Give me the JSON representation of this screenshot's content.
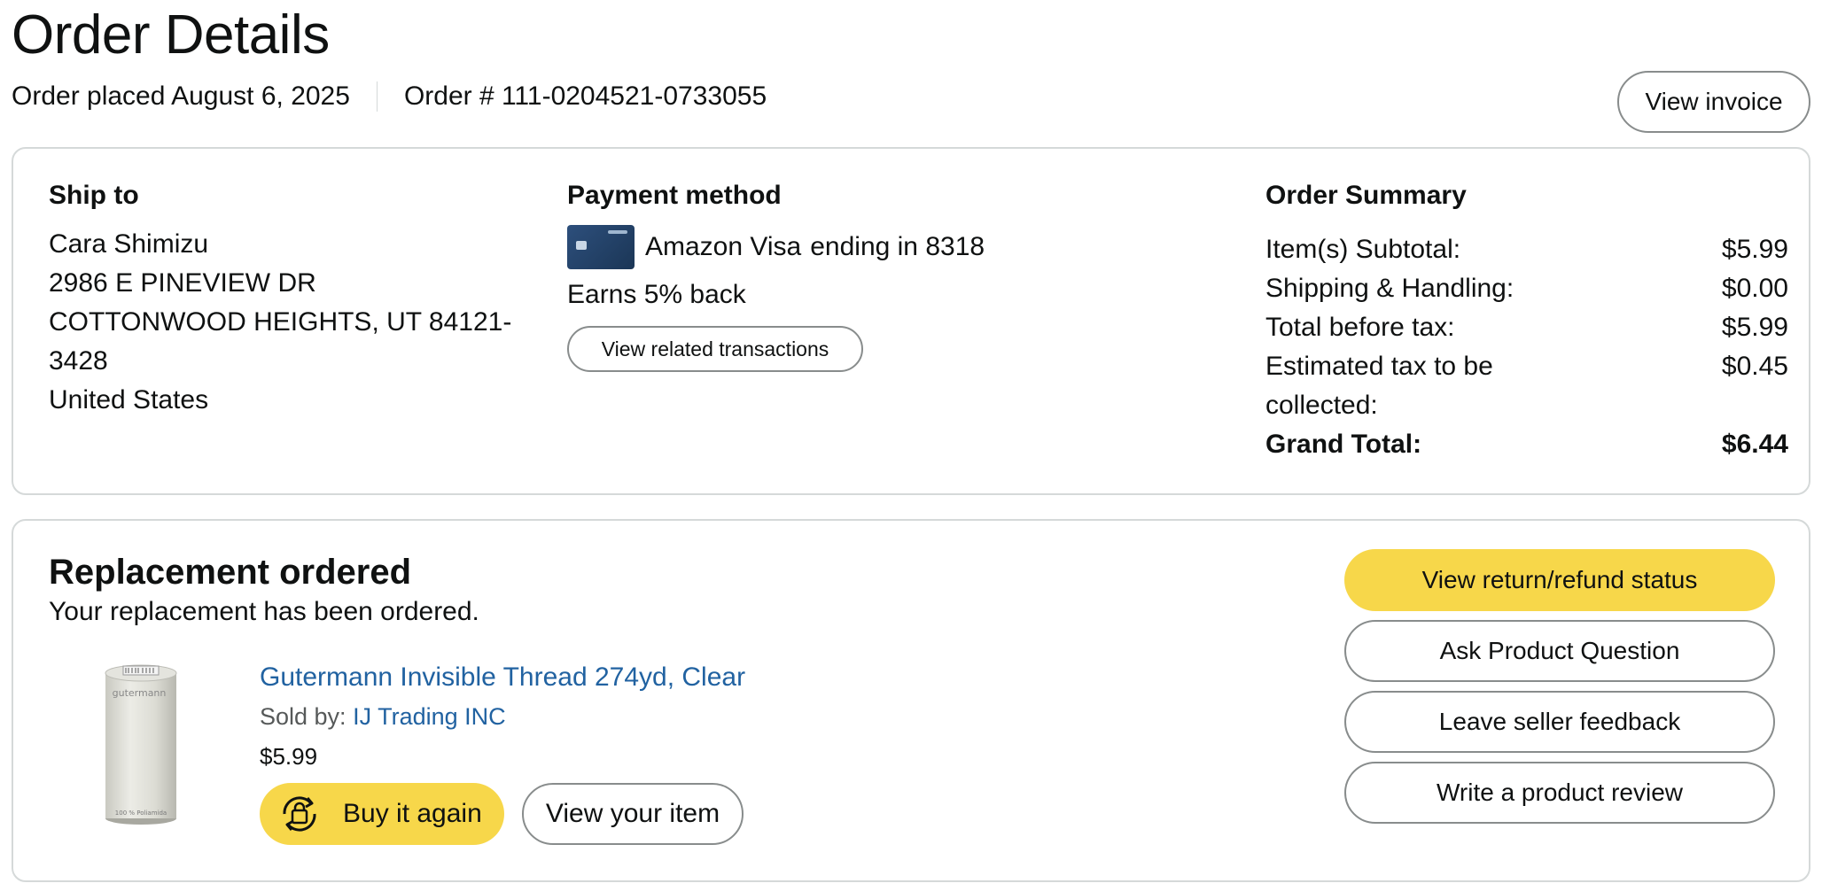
{
  "header": {
    "title": "Order Details",
    "order_placed": "Order placed August 6, 2025",
    "order_number": "Order # 111-0204521-0733055",
    "view_invoice": "View invoice"
  },
  "ship_to": {
    "heading": "Ship to",
    "name": "Cara Shimizu",
    "street": "2986 E PINEVIEW DR",
    "city_line": "COTTONWOOD HEIGHTS, UT 84121-",
    "zip_cont": "3428",
    "country": "United States"
  },
  "payment": {
    "heading": "Payment method",
    "card_name": "Amazon Visa",
    "ending": "ending in 8318",
    "earns": "Earns 5% back",
    "related_button": "View related transactions"
  },
  "summary": {
    "heading": "Order Summary",
    "rows": [
      {
        "label": "Item(s) Subtotal:",
        "value": "$5.99"
      },
      {
        "label": "Shipping & Handling:",
        "value": "$0.00"
      },
      {
        "label": "Total before tax:",
        "value": "$5.99"
      },
      {
        "label": "Estimated tax to be collected:",
        "value": "$0.45"
      }
    ],
    "grand_label": "Grand Total:",
    "grand_value": "$6.44"
  },
  "replacement": {
    "title": "Replacement ordered",
    "subtitle": "Your replacement has been ordered.",
    "product": {
      "title": "Gutermann Invisible Thread 274yd, Clear",
      "sold_by_label": "Sold by:",
      "seller": "IJ Trading INC",
      "price": "$5.99",
      "spool_brand": "gutermann",
      "spool_material": "100 % Poliamida"
    },
    "buy_again": "Buy it again",
    "view_item": "View your item",
    "actions": [
      "View return/refund status",
      "Ask Product Question",
      "Leave seller feedback",
      "Write a product review"
    ]
  },
  "colors": {
    "accent_yellow": "#f7d74a",
    "link_blue": "#2162a1",
    "border": "#d5d9d9"
  }
}
